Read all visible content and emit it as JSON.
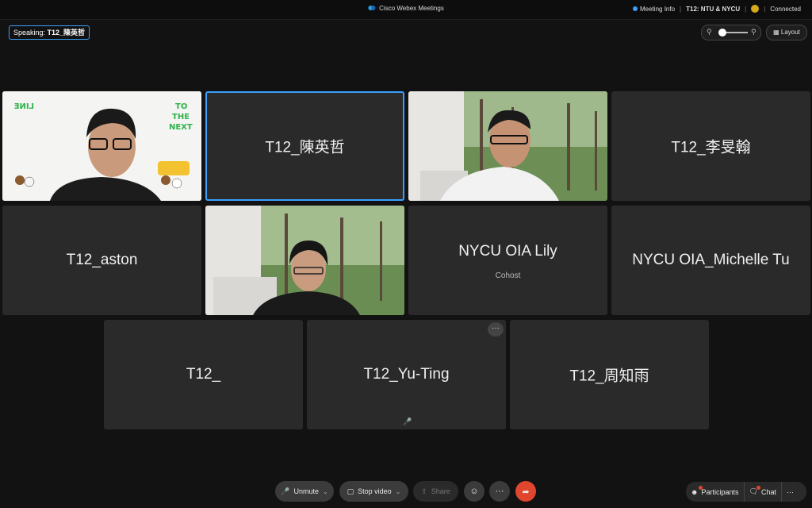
{
  "titlebar": {
    "app_title": "Cisco Webex Meetings",
    "meeting_info": "Meeting Info",
    "meeting_name": "T12: NTU & NYCU",
    "status": "Connected"
  },
  "speaking": {
    "label": "Speaking:",
    "name": "T12_陳英哲"
  },
  "view": {
    "layout_label": "Layout",
    "zoom_level": 0
  },
  "participants": [
    {
      "name": "",
      "video": true
    },
    {
      "name": "T12_陳英哲",
      "video": false,
      "active_speaker": true
    },
    {
      "name": "",
      "video": true
    },
    {
      "name": "T12_李旻翰",
      "video": false
    },
    {
      "name": "T12_aston",
      "video": false
    },
    {
      "name": "",
      "video": true
    },
    {
      "name": "NYCU OIA Lily",
      "role": "Cohost",
      "video": false
    },
    {
      "name": "NYCU OIA_Michelle Tu",
      "video": false
    },
    {
      "name": "T12_",
      "video": false
    },
    {
      "name": "T12_Yu-Ting",
      "video": false,
      "muted": true
    },
    {
      "name": "T12_周知雨",
      "video": false
    }
  ],
  "video_tile": {
    "bg_text": [
      "LINE",
      "TO",
      "THE",
      "NEXT"
    ]
  },
  "controls": {
    "unmute": "Unmute",
    "stop_video": "Stop video",
    "share": "Share",
    "more_symbol": "···",
    "participants": "Participants",
    "chat": "Chat"
  },
  "colors": {
    "accent": "#3aa0ff",
    "leave": "#e0452e",
    "tile_bg": "#2a2a2a",
    "page_bg": "#121212"
  }
}
